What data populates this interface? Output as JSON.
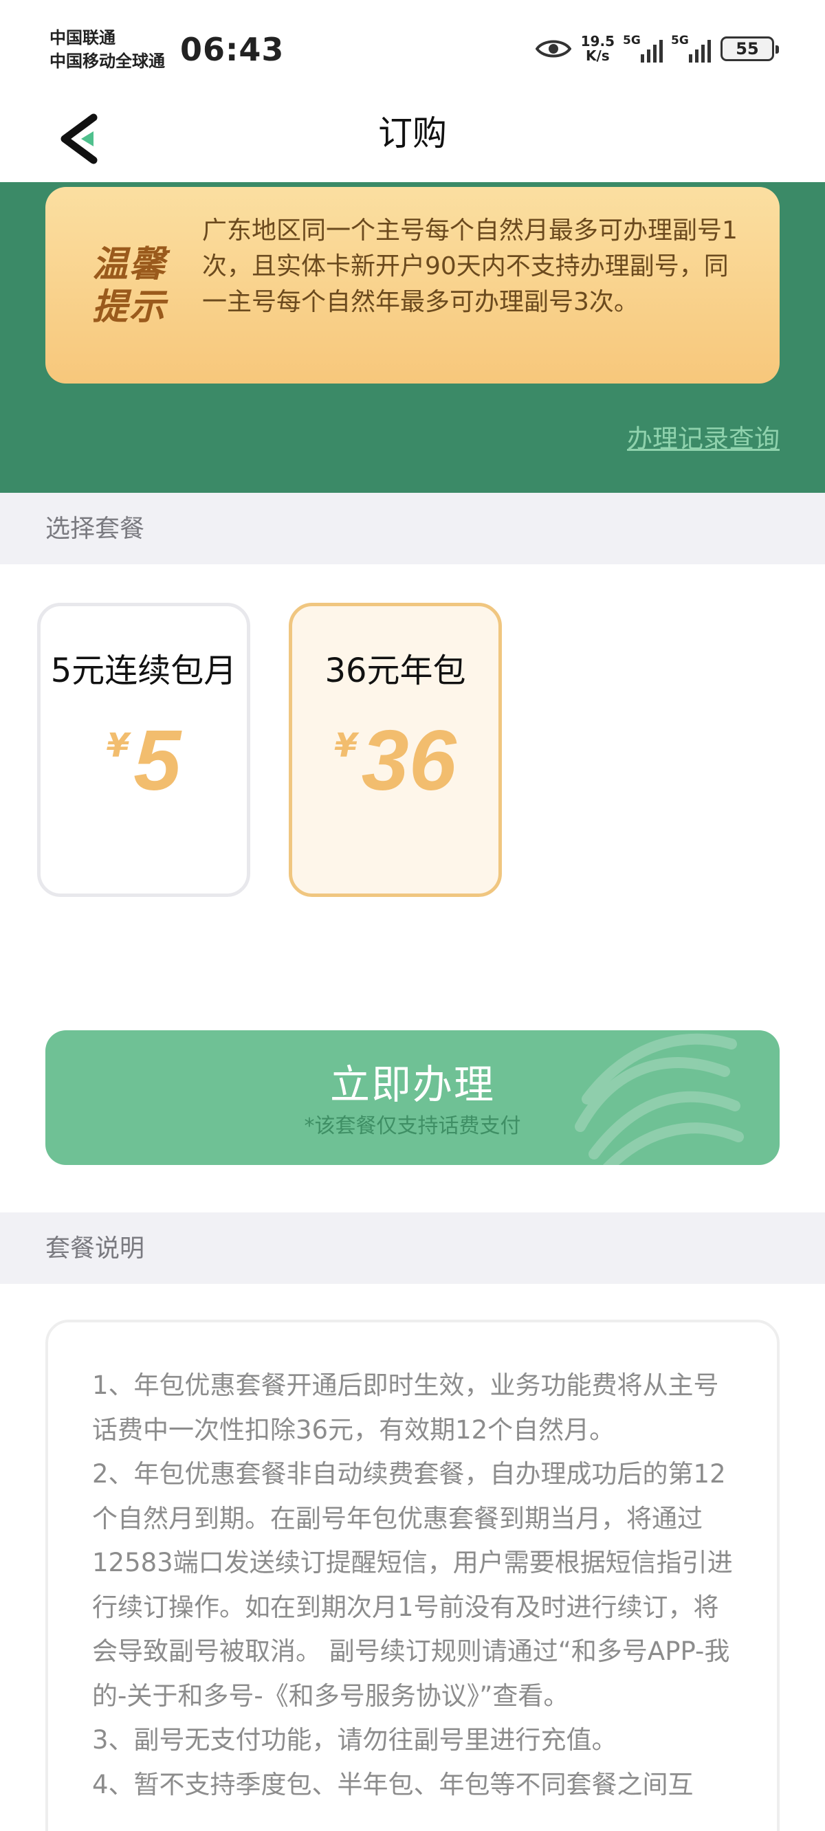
{
  "status_bar": {
    "carrier_line1": "中国联通",
    "carrier_line2": "中国移动全球通",
    "time": "06:43",
    "net_speed_value": "19.5",
    "net_speed_unit": "K/s",
    "signal1_label": "5G",
    "signal2_label": "5G",
    "battery": "55"
  },
  "nav": {
    "title": "订购"
  },
  "notice": {
    "badge_line1": "温馨",
    "badge_line2": "提示",
    "text": "广东地区同一个主号每个自然月最多可办理副号1次，且实体卡新开户90天内不支持办理副号，同一主号每个自然年最多可办理副号3次。"
  },
  "record_link": "办理记录查询",
  "choose_section": {
    "title": "选择套餐"
  },
  "packages": [
    {
      "name": "5元连续包月",
      "currency": "¥",
      "price": "5",
      "selected": false
    },
    {
      "name": "36元年包",
      "currency": "¥",
      "price": "36",
      "selected": true
    }
  ],
  "action": {
    "label": "立即办理",
    "note": "*该套餐仅支持话费支付"
  },
  "desc_section": {
    "title": "套餐说明"
  },
  "description": {
    "p1": "1、年包优惠套餐开通后即时生效，业务功能费将从主号话费中一次性扣除36元，有效期12个自然月。",
    "p2": "2、年包优惠套餐非自动续费套餐，自办理成功后的第12个自然月到期。在副号年包优惠套餐到期当月，将通过12583端口发送续订提醒短信，用户需要根据短信指引进行续订操作。如在到期次月1号前没有及时进行续订，将会导致副号被取消。 副号续订规则请通过“和多号APP-我的-关于和多号-《和多号服务协议》”查看。",
    "p3": "3、副号无支付功能，请勿往副号里进行充值。",
    "p4": "4、暂不支持季度包、半年包、年包等不同套餐之间互"
  },
  "colors": {
    "header_green": "#3b8a67",
    "button_green": "#6fc195",
    "price_gold": "#f2bd6e",
    "notice_bg": "#f7c77b"
  }
}
